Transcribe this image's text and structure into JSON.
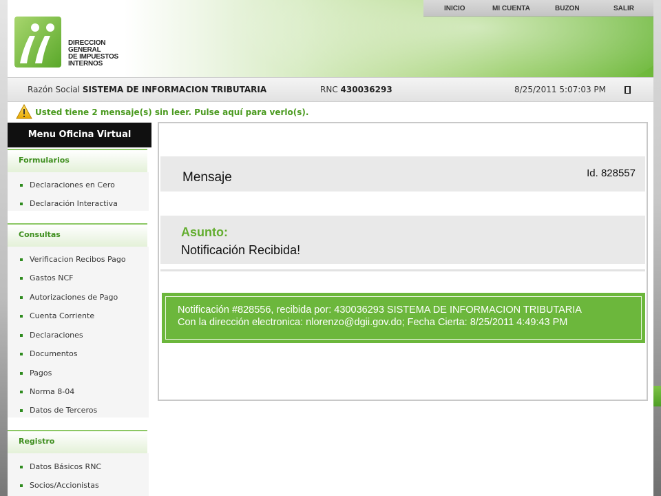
{
  "header": {
    "logo": {
      "mark": "ii",
      "text_lines": [
        "DIRECCION GENERAL",
        "DE IMPUESTOS",
        "INTERNOS"
      ]
    },
    "nav": [
      {
        "label": "INICIO"
      },
      {
        "label": "MI CUENTA"
      },
      {
        "label": "BUZON"
      },
      {
        "label": "SALIR"
      }
    ]
  },
  "infobar": {
    "razon_label": "Razón Social",
    "razon_value": "SISTEMA DE INFORMACION TRIBUTARIA",
    "rnc_label": "RNC",
    "rnc_value": "430036293",
    "datetime": "8/25/2011 5:07:03 PM"
  },
  "alert": {
    "icon": "warning-icon",
    "text": "Usted tiene 2 mensaje(s) sin leer. Pulse aquí para verlo(s)."
  },
  "sidebar": {
    "title": "Menu Oficina Virtual",
    "sections": [
      {
        "title": "Formularios",
        "items": [
          "Declaraciones en Cero",
          "Declaración Interactiva"
        ]
      },
      {
        "title": "Consultas",
        "items": [
          "Verificacion Recibos Pago",
          "Gastos NCF",
          "Autorizaciones de Pago",
          "Cuenta Corriente",
          "Declaraciones",
          "Documentos",
          "Pagos",
          "Norma 8-04",
          "Datos de Terceros"
        ]
      },
      {
        "title": "Registro",
        "items": [
          "Datos Básicos RNC",
          "Socios/Accionistas"
        ]
      }
    ]
  },
  "message": {
    "title": "Mensaje",
    "id": "Id. 828557",
    "subject_label": "Asunto:",
    "subject": "Notificación Recibida!",
    "body_lines": [
      "Notificación #828556, recibida por: 430036293 SISTEMA DE INFORMACION TRIBUTARIA",
      "Con la dirección electronica: nlorenzo@dgii.gov.do; Fecha Cierta: 8/25/2011 4:49:43 PM"
    ]
  },
  "colors": {
    "brand_green": "#6cb73c",
    "link_green": "#3f8f1f",
    "menu_title_bg": "#101010"
  }
}
